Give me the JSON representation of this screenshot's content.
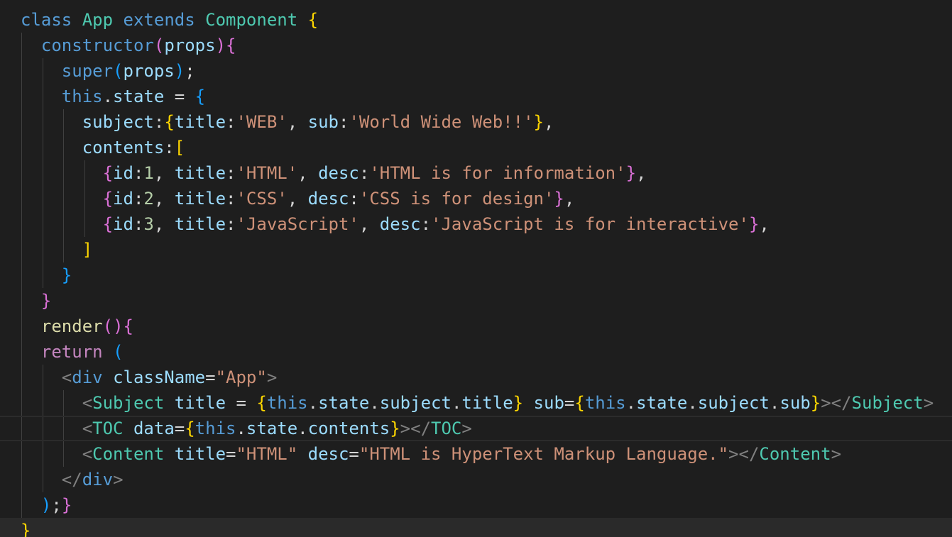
{
  "editor": {
    "lines": [
      [
        [
          "class",
          "kw-blue"
        ],
        [
          " ",
          "plain"
        ],
        [
          "App",
          "cls"
        ],
        [
          " ",
          "plain"
        ],
        [
          "extends",
          "kw-blue"
        ],
        [
          " ",
          "plain"
        ],
        [
          "Component",
          "cls"
        ],
        [
          " ",
          "plain"
        ],
        [
          "{",
          "br1"
        ]
      ],
      [
        [
          "  ",
          "plain"
        ],
        [
          "constructor",
          "kw-blue"
        ],
        [
          "(",
          "br2"
        ],
        [
          "props",
          "prop"
        ],
        [
          ")",
          "br2"
        ],
        [
          "{",
          "br2"
        ]
      ],
      [
        [
          "    ",
          "plain"
        ],
        [
          "super",
          "kw-blue"
        ],
        [
          "(",
          "br3"
        ],
        [
          "props",
          "prop"
        ],
        [
          ")",
          "br3"
        ],
        [
          ";",
          "plain"
        ]
      ],
      [
        [
          "    ",
          "plain"
        ],
        [
          "this",
          "kw-blue"
        ],
        [
          ".",
          "plain"
        ],
        [
          "state",
          "prop"
        ],
        [
          " = ",
          "plain"
        ],
        [
          "{",
          "br3"
        ]
      ],
      [
        [
          "      ",
          "plain"
        ],
        [
          "subject",
          "prop"
        ],
        [
          ":",
          "plain"
        ],
        [
          "{",
          "br1"
        ],
        [
          "title",
          "prop"
        ],
        [
          ":",
          "plain"
        ],
        [
          "'WEB'",
          "str"
        ],
        [
          ", ",
          "plain"
        ],
        [
          "sub",
          "prop"
        ],
        [
          ":",
          "plain"
        ],
        [
          "'World Wide Web!!'",
          "str"
        ],
        [
          "}",
          "br1"
        ],
        [
          ",",
          "plain"
        ]
      ],
      [
        [
          "      ",
          "plain"
        ],
        [
          "contents",
          "prop"
        ],
        [
          ":",
          "plain"
        ],
        [
          "[",
          "br1"
        ]
      ],
      [
        [
          "        ",
          "plain"
        ],
        [
          "{",
          "br2"
        ],
        [
          "id",
          "prop"
        ],
        [
          ":",
          "plain"
        ],
        [
          "1",
          "num"
        ],
        [
          ", ",
          "plain"
        ],
        [
          "title",
          "prop"
        ],
        [
          ":",
          "plain"
        ],
        [
          "'HTML'",
          "str"
        ],
        [
          ", ",
          "plain"
        ],
        [
          "desc",
          "prop"
        ],
        [
          ":",
          "plain"
        ],
        [
          "'HTML is for information'",
          "str"
        ],
        [
          "}",
          "br2"
        ],
        [
          ",",
          "plain"
        ]
      ],
      [
        [
          "        ",
          "plain"
        ],
        [
          "{",
          "br2"
        ],
        [
          "id",
          "prop"
        ],
        [
          ":",
          "plain"
        ],
        [
          "2",
          "num"
        ],
        [
          ", ",
          "plain"
        ],
        [
          "title",
          "prop"
        ],
        [
          ":",
          "plain"
        ],
        [
          "'CSS'",
          "str"
        ],
        [
          ", ",
          "plain"
        ],
        [
          "desc",
          "prop"
        ],
        [
          ":",
          "plain"
        ],
        [
          "'CSS is for design'",
          "str"
        ],
        [
          "}",
          "br2"
        ],
        [
          ",",
          "plain"
        ]
      ],
      [
        [
          "        ",
          "plain"
        ],
        [
          "{",
          "br2"
        ],
        [
          "id",
          "prop"
        ],
        [
          ":",
          "plain"
        ],
        [
          "3",
          "num"
        ],
        [
          ", ",
          "plain"
        ],
        [
          "title",
          "prop"
        ],
        [
          ":",
          "plain"
        ],
        [
          "'JavaScript'",
          "str"
        ],
        [
          ", ",
          "plain"
        ],
        [
          "desc",
          "prop"
        ],
        [
          ":",
          "plain"
        ],
        [
          "'JavaScript is for interactive'",
          "str"
        ],
        [
          "}",
          "br2"
        ],
        [
          ",",
          "plain"
        ]
      ],
      [
        [
          "      ",
          "plain"
        ],
        [
          "]",
          "br1"
        ]
      ],
      [
        [
          "    ",
          "plain"
        ],
        [
          "}",
          "br3"
        ]
      ],
      [
        [
          "  ",
          "plain"
        ],
        [
          "}",
          "br2"
        ]
      ],
      [
        [
          "  ",
          "plain"
        ],
        [
          "render",
          "fn"
        ],
        [
          "(",
          "br2"
        ],
        [
          ")",
          "br2"
        ],
        [
          "{",
          "br2"
        ]
      ],
      [
        [
          "  ",
          "plain"
        ],
        [
          "return",
          "ctrl"
        ],
        [
          " ",
          "plain"
        ],
        [
          "(",
          "br3"
        ]
      ],
      [
        [
          "    ",
          "plain"
        ],
        [
          "<",
          "tagp"
        ],
        [
          "div",
          "kw-blue"
        ],
        [
          " ",
          "plain"
        ],
        [
          "className",
          "prop"
        ],
        [
          "=",
          "plain"
        ],
        [
          "\"App\"",
          "str"
        ],
        [
          ">",
          "tagp"
        ]
      ],
      [
        [
          "      ",
          "plain"
        ],
        [
          "<",
          "tagp"
        ],
        [
          "Subject",
          "cls"
        ],
        [
          " ",
          "plain"
        ],
        [
          "title",
          "prop"
        ],
        [
          " = ",
          "plain"
        ],
        [
          "{",
          "br1"
        ],
        [
          "this",
          "kw-blue"
        ],
        [
          ".",
          "plain"
        ],
        [
          "state",
          "prop"
        ],
        [
          ".",
          "plain"
        ],
        [
          "subject",
          "prop"
        ],
        [
          ".",
          "plain"
        ],
        [
          "title",
          "prop"
        ],
        [
          "}",
          "br1"
        ],
        [
          " ",
          "plain"
        ],
        [
          "sub",
          "prop"
        ],
        [
          "=",
          "plain"
        ],
        [
          "{",
          "br1"
        ],
        [
          "this",
          "kw-blue"
        ],
        [
          ".",
          "plain"
        ],
        [
          "state",
          "prop"
        ],
        [
          ".",
          "plain"
        ],
        [
          "subject",
          "prop"
        ],
        [
          ".",
          "plain"
        ],
        [
          "sub",
          "prop"
        ],
        [
          "}",
          "br1"
        ],
        [
          "></",
          "tagp"
        ],
        [
          "Subject",
          "cls"
        ],
        [
          ">",
          "tagp"
        ]
      ],
      [
        [
          "      ",
          "plain"
        ],
        [
          "<",
          "tagp"
        ],
        [
          "TOC",
          "cls"
        ],
        [
          " ",
          "plain"
        ],
        [
          "data",
          "prop"
        ],
        [
          "=",
          "plain"
        ],
        [
          "{",
          "br1"
        ],
        [
          "this",
          "kw-blue"
        ],
        [
          ".",
          "plain"
        ],
        [
          "state",
          "prop"
        ],
        [
          ".",
          "plain"
        ],
        [
          "contents",
          "prop"
        ],
        [
          "}",
          "br1"
        ],
        [
          "></",
          "tagp"
        ],
        [
          "TOC",
          "cls"
        ],
        [
          ">",
          "tagp"
        ]
      ],
      [
        [
          "      ",
          "plain"
        ],
        [
          "<",
          "tagp"
        ],
        [
          "Content",
          "cls"
        ],
        [
          " ",
          "plain"
        ],
        [
          "title",
          "prop"
        ],
        [
          "=",
          "plain"
        ],
        [
          "\"HTML\"",
          "str"
        ],
        [
          " ",
          "plain"
        ],
        [
          "desc",
          "prop"
        ],
        [
          "=",
          "plain"
        ],
        [
          "\"HTML is HyperText Markup Language.\"",
          "str"
        ],
        [
          "></",
          "tagp"
        ],
        [
          "Content",
          "cls"
        ],
        [
          ">",
          "tagp"
        ]
      ],
      [
        [
          "    ",
          "plain"
        ],
        [
          "</",
          "tagp"
        ],
        [
          "div",
          "kw-blue"
        ],
        [
          ">",
          "tagp"
        ]
      ],
      [
        [
          "  ",
          "plain"
        ],
        [
          ")",
          "br3"
        ],
        [
          ";",
          "plain"
        ],
        [
          "}",
          "br2"
        ]
      ],
      [
        [
          "}",
          "br1"
        ]
      ]
    ],
    "cursor_line": 16
  }
}
